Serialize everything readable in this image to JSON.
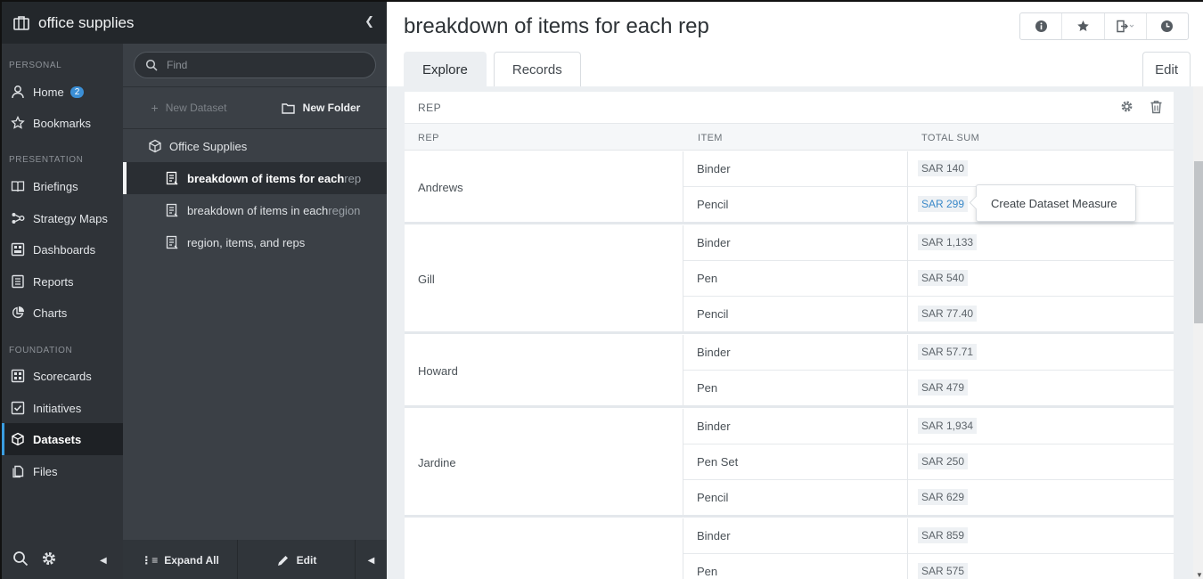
{
  "app": {
    "title": "office supplies"
  },
  "search": {
    "placeholder": "Find"
  },
  "nav": {
    "sections": {
      "personal": "PERSONAL",
      "presentation": "PRESENTATION",
      "foundation": "FOUNDATION"
    },
    "items": [
      {
        "label": "Home",
        "icon": "home-icon"
      },
      {
        "label": "Bookmarks",
        "icon": "star-icon"
      },
      {
        "label": "Briefings",
        "icon": "book-icon"
      },
      {
        "label": "Strategy Maps",
        "icon": "strategy-map-icon"
      },
      {
        "label": "Dashboards",
        "icon": "dashboard-icon"
      },
      {
        "label": "Reports",
        "icon": "report-icon"
      },
      {
        "label": "Charts",
        "icon": "pie-chart-icon"
      },
      {
        "label": "Scorecards",
        "icon": "scorecard-icon"
      },
      {
        "label": "Initiatives",
        "icon": "checkbox-icon"
      },
      {
        "label": "Datasets",
        "icon": "cube-icon"
      },
      {
        "label": "Files",
        "icon": "files-icon"
      }
    ],
    "home_badge": "2"
  },
  "panel": {
    "new_dataset": "New Dataset",
    "new_folder": "New Folder",
    "tree": {
      "folder": "Office Supplies",
      "items": [
        {
          "main": "breakdown of items for each",
          "fade": " rep"
        },
        {
          "main": "breakdown of items in each ",
          "fade": "region"
        },
        {
          "main": "region, items, and reps",
          "fade": ""
        }
      ]
    },
    "expand_all": "Expand All",
    "edit": "Edit"
  },
  "main": {
    "title": "breakdown of items for each rep",
    "tabs": [
      "Explore",
      "Records"
    ],
    "edit_label": "Edit",
    "card_title": "REP",
    "columns": [
      "REP",
      "ITEM",
      "TOTAL SUM"
    ],
    "tooltip": "Create Dataset Measure",
    "groups": [
      {
        "rep": "Andrews",
        "rows": [
          {
            "item": "Binder",
            "value": "SAR 140"
          },
          {
            "item": "Pencil",
            "value": "SAR 299"
          }
        ]
      },
      {
        "rep": "Gill",
        "rows": [
          {
            "item": "Binder",
            "value": "SAR 1,133"
          },
          {
            "item": "Pen",
            "value": "SAR 540"
          },
          {
            "item": "Pencil",
            "value": "SAR 77.40"
          }
        ]
      },
      {
        "rep": "Howard",
        "rows": [
          {
            "item": "Binder",
            "value": "SAR 57.71"
          },
          {
            "item": "Pen",
            "value": "SAR 479"
          }
        ]
      },
      {
        "rep": "Jardine",
        "rows": [
          {
            "item": "Binder",
            "value": "SAR 1,934"
          },
          {
            "item": "Pen Set",
            "value": "SAR 250"
          },
          {
            "item": "Pencil",
            "value": "SAR 629"
          }
        ]
      },
      {
        "rep": "",
        "rows": [
          {
            "item": "Binder",
            "value": "SAR 859"
          },
          {
            "item": "Pen",
            "value": "SAR 575"
          }
        ]
      }
    ]
  },
  "colors": {
    "accent": "#3a9de0",
    "link": "#3a89c9",
    "sidebar": "#2f3338",
    "panel": "#3b4046"
  }
}
